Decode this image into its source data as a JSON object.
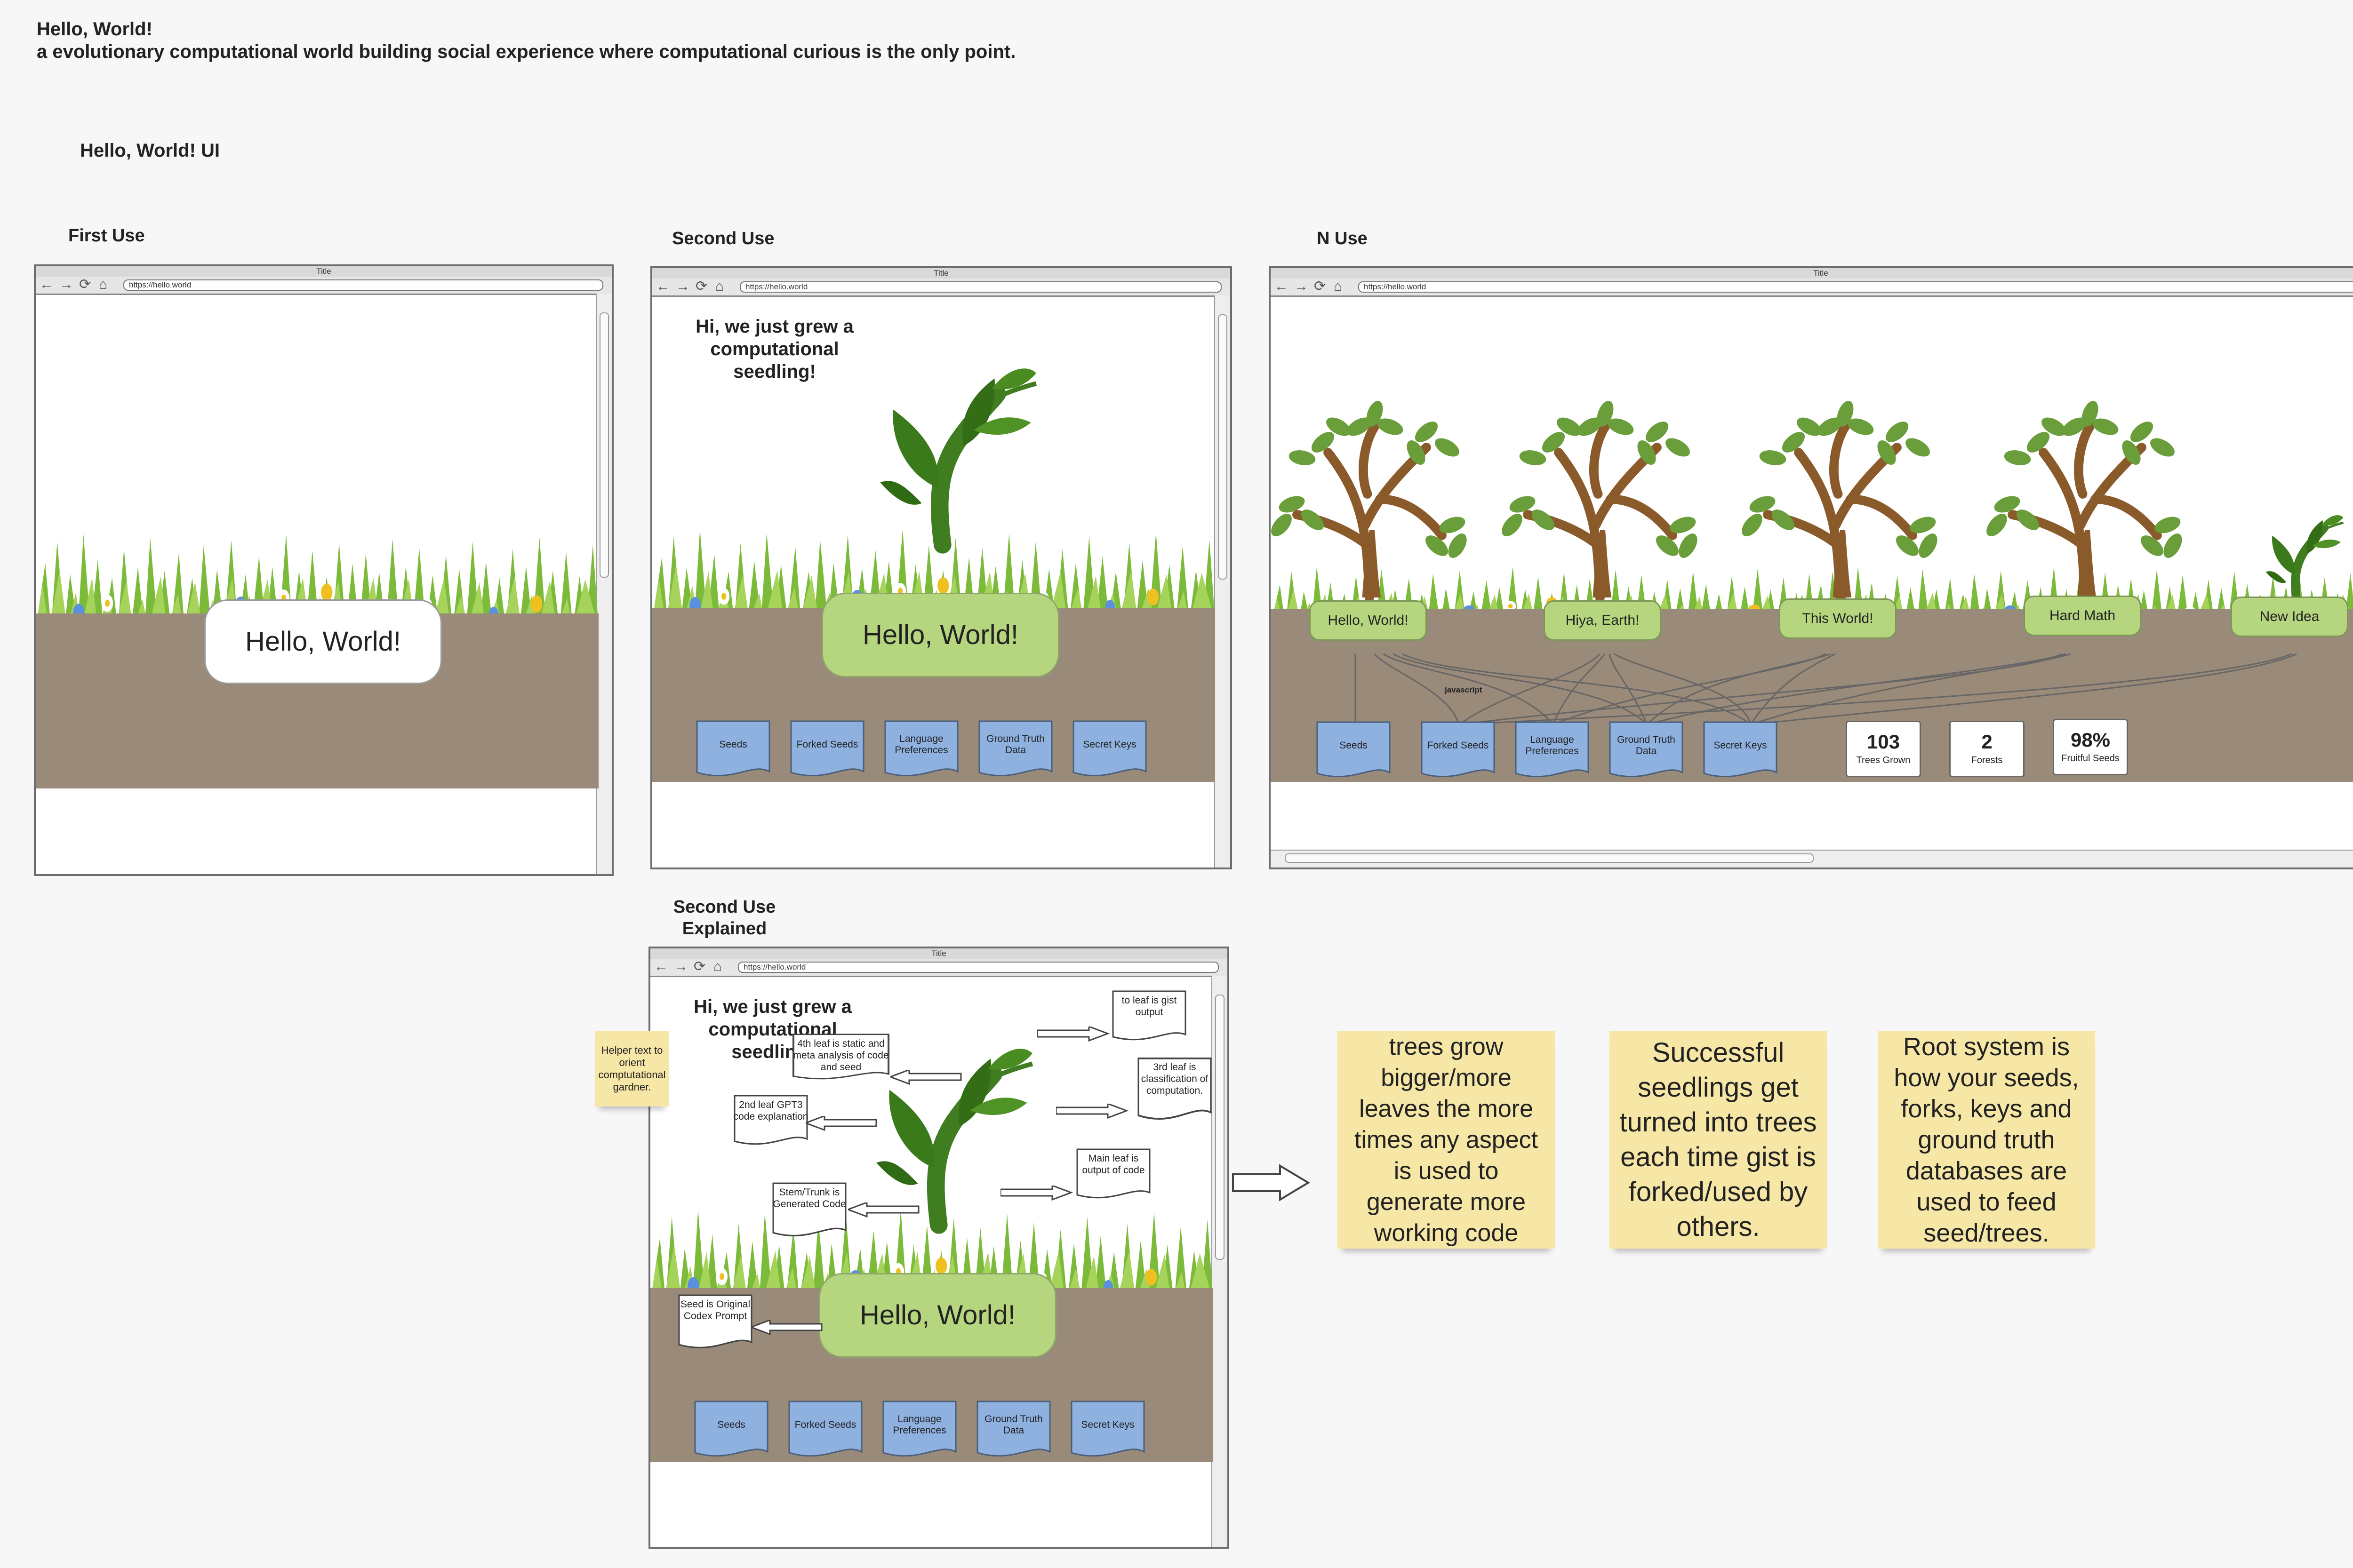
{
  "header": {
    "title": "Hello, World!",
    "subtitle": "a evolutionary computational world building social experience where computational curious is the only point.",
    "ui_title": "Hello, World! UI"
  },
  "browser": {
    "title": "Title",
    "url": "https://hello.world"
  },
  "panels": {
    "first": {
      "label": "First Use",
      "hello": "Hello, World!"
    },
    "second": {
      "label": "Second Use",
      "greeting_line1": "Hi, we just grew a",
      "greeting_line2": "computational seedling!",
      "hello": "Hello, World!"
    },
    "nuse": {
      "label": "N Use",
      "trees": [
        "Hello, World!",
        "Hiya, Earth!",
        "This World!",
        "Hard Math",
        "New Idea"
      ],
      "connector_label": "javascript",
      "stats": [
        {
          "value": "103",
          "label": "Trees Grown"
        },
        {
          "value": "2",
          "label": "Forests"
        },
        {
          "value": "98%",
          "label": "Fruitful Seeds"
        }
      ]
    },
    "explained": {
      "label_line1": "Second Use",
      "label_line2": "Explained",
      "greeting_line1": "Hi, we just grew a",
      "greeting_line2": "computational seedling!",
      "hello": "Hello, World!",
      "helper_note": "Helper text to orient comptutational gardner.",
      "callouts": {
        "top_leaf": "to leaf is gist output",
        "fourth_leaf": "4th leaf is static and meta analysis of code and seed",
        "third_leaf": "3rd leaf is classification of computation.",
        "second_leaf": "2nd leaf GPT3 code explanation",
        "main_leaf": "Main leaf is output of code",
        "stem": "Stem/Trunk is Generated Code",
        "seed": "Seed is Original Codex Prompt"
      }
    }
  },
  "tabs": [
    "Seeds",
    "Forked Seeds",
    "Language Preferences",
    "Ground Truth Data",
    "Secret Keys"
  ],
  "notes": [
    "trees grow bigger/more leaves the more times any aspect is used to generate more working code",
    "Successful seedlings get turned into trees each time gist is forked/used by others.",
    "Root system is how your seeds, forks, keys and ground truth databases are used to feed seed/trees."
  ],
  "colors": {
    "soil": "#9a8a79",
    "tab": "#8eb1e0",
    "leaf": "#b5d67f",
    "sticky": "#f7e7a6",
    "grass": "#7cba3a"
  }
}
